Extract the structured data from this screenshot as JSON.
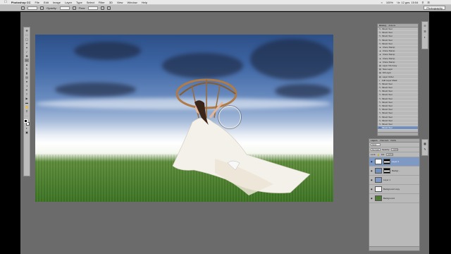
{
  "menubar": {
    "app_name": "Photoshop CC",
    "items": [
      "File",
      "Edit",
      "Image",
      "Layer",
      "Type",
      "Select",
      "Filter",
      "3D",
      "View",
      "Window",
      "Help"
    ],
    "datetime": "Чт. 12 дек. 15:54",
    "battery": "100%"
  },
  "options": {
    "opacity_label": "Opacity:",
    "flow_label": "Flow:",
    "workspace": "Photography"
  },
  "history": {
    "tabs": [
      "History",
      "Actions"
    ],
    "items": [
      {
        "label": "Brush Tool",
        "icon": "brush"
      },
      {
        "label": "Brush Tool",
        "icon": "brush"
      },
      {
        "label": "Brush Tool",
        "icon": "brush"
      },
      {
        "label": "Brush Tool",
        "icon": "brush"
      },
      {
        "label": "Brush Tool",
        "icon": "brush"
      },
      {
        "label": "Clone Stamp",
        "icon": "stamp"
      },
      {
        "label": "Clone Stamp",
        "icon": "stamp"
      },
      {
        "label": "Clone Stamp",
        "icon": "stamp"
      },
      {
        "label": "Clone Stamp",
        "icon": "stamp"
      },
      {
        "label": "Clone Stamp",
        "icon": "stamp"
      },
      {
        "label": "Layer Via Copy",
        "icon": "layer"
      },
      {
        "label": "New Layer",
        "icon": "layer"
      },
      {
        "label": "Fill Layer",
        "icon": "layer"
      },
      {
        "label": "Layer Order",
        "icon": "layer"
      },
      {
        "label": "Add Layer Mask",
        "icon": "mask"
      },
      {
        "label": "Brush Tool",
        "icon": "brush"
      },
      {
        "label": "Brush Tool",
        "icon": "brush"
      },
      {
        "label": "Brush Tool",
        "icon": "brush"
      },
      {
        "label": "Brush Tool",
        "icon": "brush"
      },
      {
        "label": "Brush Tool",
        "icon": "brush"
      },
      {
        "label": "Brush Tool",
        "icon": "brush"
      },
      {
        "label": "Brush Tool",
        "icon": "brush"
      },
      {
        "label": "Brush Tool",
        "icon": "brush"
      },
      {
        "label": "Brush Tool",
        "icon": "brush"
      },
      {
        "label": "Brush Tool",
        "icon": "brush"
      },
      {
        "label": "Brush Tool",
        "icon": "brush"
      },
      {
        "label": "Brush Tool",
        "icon": "brush"
      },
      {
        "label": "Brush Tool",
        "icon": "brush"
      }
    ],
    "selected_index": 27
  },
  "layers": {
    "tabs": [
      "Layers",
      "Channels",
      "Paths"
    ],
    "kind": "Kind",
    "blend_mode": "Normal",
    "opacity_label": "Opacity:",
    "opacity_value": "100%",
    "lock_label": "Lock:",
    "fill_label": "Fill:",
    "fill_value": "100%",
    "rows": [
      {
        "name": "Layer 2",
        "selected": true,
        "has_mask": true,
        "thumb": "#ffffff"
      },
      {
        "name": "Backgr...",
        "selected": false,
        "has_mask": true,
        "thumb": "#6f8fbf"
      },
      {
        "name": "Layer 1",
        "selected": false,
        "has_mask": false,
        "thumb": "#7f99c5"
      },
      {
        "name": "Background copy",
        "selected": false,
        "has_mask": false,
        "thumb": "#f4f4f4"
      },
      {
        "name": "Background",
        "selected": false,
        "has_mask": false,
        "thumb": "#4f7b35"
      }
    ]
  },
  "colors": {
    "selection": "#6f8fbf",
    "panel_bg": "#b9b9b9",
    "workspace_bg": "#6b6b6b"
  }
}
